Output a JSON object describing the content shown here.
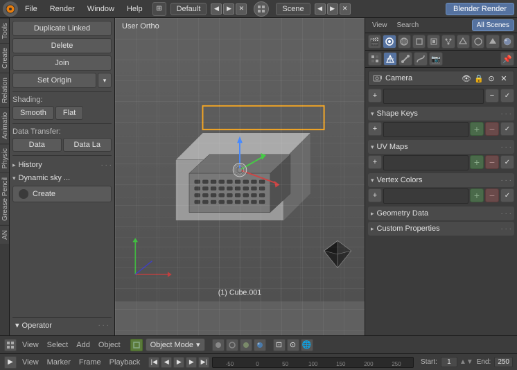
{
  "topbar": {
    "icon": "🔵",
    "menus": [
      "File",
      "Render",
      "Window",
      "Help"
    ],
    "layout": "Default",
    "scene": "Scene",
    "render_engine": "Blender Render",
    "arrows_left": "◀",
    "arrows_right": "▶"
  },
  "left_panel": {
    "buttons": {
      "duplicate_linked": "Duplicate Linked",
      "delete": "Delete",
      "join": "Join",
      "set_origin": "Set Origin"
    },
    "shading_label": "Shading:",
    "smooth_label": "Smooth",
    "flat_label": "Flat",
    "data_transfer_label": "Data Transfer:",
    "data_btn": "Data",
    "data_la_btn": "Data La",
    "history_label": "History",
    "dynamic_sky_label": "Dynamic sky ...",
    "create_btn": "Create",
    "operator_label": "Operator"
  },
  "viewport": {
    "header": "User Ortho",
    "object_label": "(1) Cube.001"
  },
  "right_panel": {
    "tabs": {
      "view_label": "View",
      "search_label": "Search",
      "all_scenes_label": "All Scenes"
    },
    "camera_name": "Camera",
    "sections": {
      "shape_keys": {
        "label": "Shape Keys",
        "collapsed": false
      },
      "uv_maps": {
        "label": "UV Maps",
        "collapsed": false
      },
      "vertex_colors": {
        "label": "Vertex Colors",
        "collapsed": false
      },
      "geometry_data": {
        "label": "Geometry Data",
        "collapsed": true
      },
      "custom_properties": {
        "label": "Custom Properties",
        "collapsed": true
      }
    }
  },
  "timeline": {
    "start_label": "Start:",
    "start_val": "1",
    "end_label": "End:",
    "end_val": "250"
  },
  "bottom_bar": {
    "icon_label": "🔵",
    "menus": [
      "View",
      "Marker",
      "Frame",
      "Playback"
    ],
    "scrubber_marks": [
      "50",
      "0",
      "50",
      "100",
      "150",
      "200",
      "250"
    ]
  },
  "icons": {
    "arrow_down": "▾",
    "arrow_right": "▸",
    "triangle_down": "▼",
    "triangle_right": "▶",
    "plus": "+",
    "minus": "−",
    "dots": "· · ·",
    "gear": "⚙",
    "camera": "📷",
    "eye": "👁",
    "lock": "🔒",
    "scene": "🎬"
  }
}
